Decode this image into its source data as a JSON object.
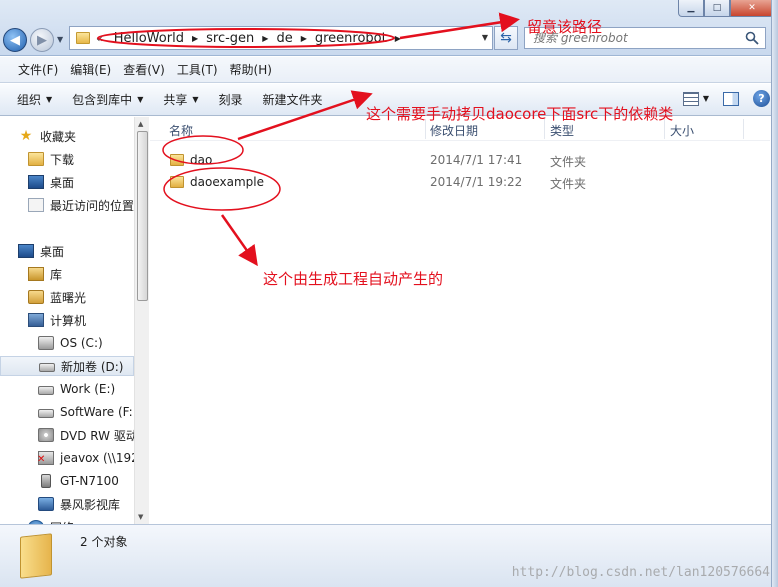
{
  "window": {
    "controls": {
      "minimize": "▁",
      "maximize": "□",
      "close": "✕"
    }
  },
  "navigation": {
    "back_icon": "back-arrow-icon",
    "forward_icon": "forward-arrow-icon",
    "address_prefix": "«",
    "breadcrumb": [
      "HelloWorld",
      "src-gen",
      "de",
      "greenrobot"
    ],
    "refresh_icon": "refresh-icon",
    "search_placeholder": "搜索 greenrobot"
  },
  "menu": {
    "items": [
      "文件(F)",
      "编辑(E)",
      "查看(V)",
      "工具(T)",
      "帮助(H)"
    ]
  },
  "commands": {
    "items": [
      {
        "label": "组织",
        "dropdown": true
      },
      {
        "label": "包含到库中",
        "dropdown": true
      },
      {
        "label": "共享",
        "dropdown": true
      },
      {
        "label": "刻录",
        "dropdown": false
      },
      {
        "label": "新建文件夹",
        "dropdown": false
      }
    ]
  },
  "sidebar": {
    "items": [
      {
        "label": "收藏夹",
        "icon": "star-icon"
      },
      {
        "label": "下载",
        "icon": "downloads-folder-icon"
      },
      {
        "label": "桌面",
        "icon": "desktop-icon"
      },
      {
        "label": "最近访问的位置",
        "icon": "recent-places-icon"
      },
      {
        "label": "桌面",
        "icon": "desktop-icon"
      },
      {
        "label": "库",
        "icon": "library-icon"
      },
      {
        "label": "蓝曙光",
        "icon": "user-folder-icon"
      },
      {
        "label": "计算机",
        "icon": "computer-icon"
      },
      {
        "label": "OS (C:)",
        "icon": "system-drive-icon"
      },
      {
        "label": "新加卷 (D:)",
        "icon": "drive-icon",
        "selected": true
      },
      {
        "label": "Work (E:)",
        "icon": "drive-icon"
      },
      {
        "label": "SoftWare (F:",
        "icon": "drive-icon"
      },
      {
        "label": "DVD RW 驱动",
        "icon": "dvd-drive-icon"
      },
      {
        "label": "jeavox (\\\\192",
        "icon": "network-drive-icon"
      },
      {
        "label": "GT-N7100",
        "icon": "phone-icon"
      },
      {
        "label": "暴风影视库",
        "icon": "media-library-icon"
      },
      {
        "label": "网络",
        "icon": "network-icon"
      }
    ]
  },
  "file_list": {
    "columns": [
      "名称",
      "修改日期",
      "类型",
      "大小"
    ],
    "rows": [
      {
        "name": "dao",
        "modified": "2014/7/1 17:41",
        "type": "文件夹",
        "size": ""
      },
      {
        "name": "daoexample",
        "modified": "2014/7/1 19:22",
        "type": "文件夹",
        "size": ""
      }
    ]
  },
  "status": {
    "item_count": "2 个对象"
  },
  "annotations": {
    "path_note": "留意该路径",
    "copy_note": "这个需要手动拷贝daocore下面src下的依赖类",
    "generated_note": "这个由生成工程自动产生的",
    "color": "#e3101e"
  },
  "watermark": "http://blog.csdn.net/lan120576664"
}
